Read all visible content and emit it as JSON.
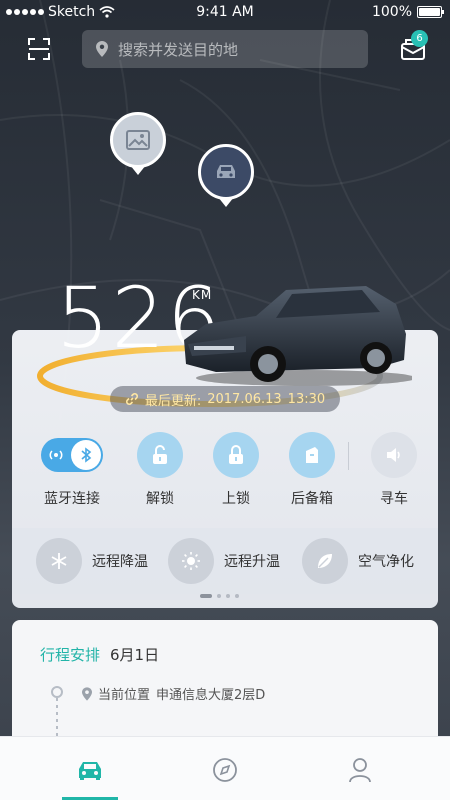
{
  "status_bar": {
    "carrier": "Sketch",
    "time": "9:41 AM",
    "battery": "100%",
    "battery_level": 1.0
  },
  "header": {
    "search_placeholder": "搜索并发送目的地",
    "message_badge": "6"
  },
  "vehicle": {
    "mileage": "526",
    "mileage_unit": "KM",
    "last_update_label": "最后更新:",
    "last_update_date": "2017.06.13",
    "last_update_time": "13:30"
  },
  "controls": [
    {
      "label": "蓝牙连接",
      "icon": "bluetooth-toggle",
      "active": true
    },
    {
      "label": "解锁",
      "icon": "unlock-icon"
    },
    {
      "label": "上锁",
      "icon": "lock-icon"
    },
    {
      "label": "后备箱",
      "icon": "trunk-icon"
    },
    {
      "label": "寻车",
      "icon": "speaker-icon"
    }
  ],
  "climate": [
    {
      "label": "远程降温",
      "icon": "snowflake-icon"
    },
    {
      "label": "远程升温",
      "icon": "sun-icon"
    },
    {
      "label": "空气净化",
      "icon": "leaf-icon"
    }
  ],
  "pager": {
    "total": 4,
    "active": 0
  },
  "trip": {
    "title": "行程安排",
    "date": "6月1日",
    "current_location_label": "当前位置",
    "current_location": "申通信息大厦2层D"
  },
  "bottom_nav": [
    {
      "name": "car",
      "icon": "car-icon",
      "active": true
    },
    {
      "name": "discover",
      "icon": "compass-icon",
      "active": false
    },
    {
      "name": "profile",
      "icon": "user-icon",
      "active": false
    }
  ],
  "colors": {
    "accent": "#20b6a8",
    "control_blue": "#a6d5f0",
    "toggle_blue": "#49a9e6",
    "update_text": "#ffe7a3"
  }
}
